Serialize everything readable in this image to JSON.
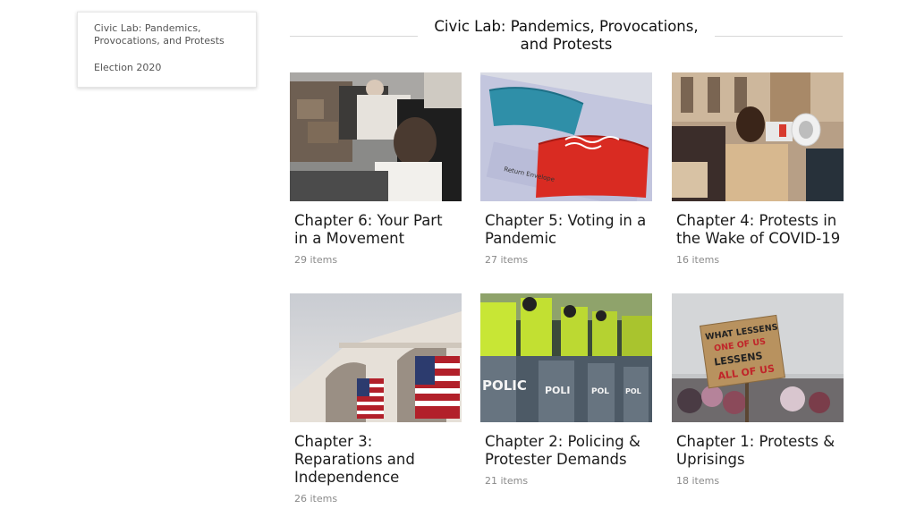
{
  "sidebar": {
    "items": [
      {
        "label": "Civic Lab: Pandemics, Provocations, and Protests"
      },
      {
        "label": "Election 2020"
      }
    ]
  },
  "header": {
    "title": "Civic Lab: Pandemics, Provocations, and Protests"
  },
  "cards": [
    {
      "title": "Chapter 6: Your Part in a Movement",
      "count": "29 items",
      "image": "protest-crowd-photo"
    },
    {
      "title": "Chapter 5: Voting in a Pandemic",
      "count": "27 items",
      "image": "masks-return-envelope-photo"
    },
    {
      "title": "Chapter 4: Protests in the Wake of COVID-19",
      "count": "16 items",
      "image": "megaphone-protester-photo"
    },
    {
      "title": "Chapter 3: Reparations and Independence",
      "count": "26 items",
      "image": "flags-on-building-photo"
    },
    {
      "title": "Chapter 2: Policing & Protester Demands",
      "count": "21 items",
      "image": "police-riot-shields-photo"
    },
    {
      "title": "Chapter 1: Protests & Uprisings",
      "count": "18 items",
      "image": "protest-sign-photo",
      "sign_text": "WHAT LESSENS ONE OF US LESSENS ALL OF US"
    }
  ]
}
